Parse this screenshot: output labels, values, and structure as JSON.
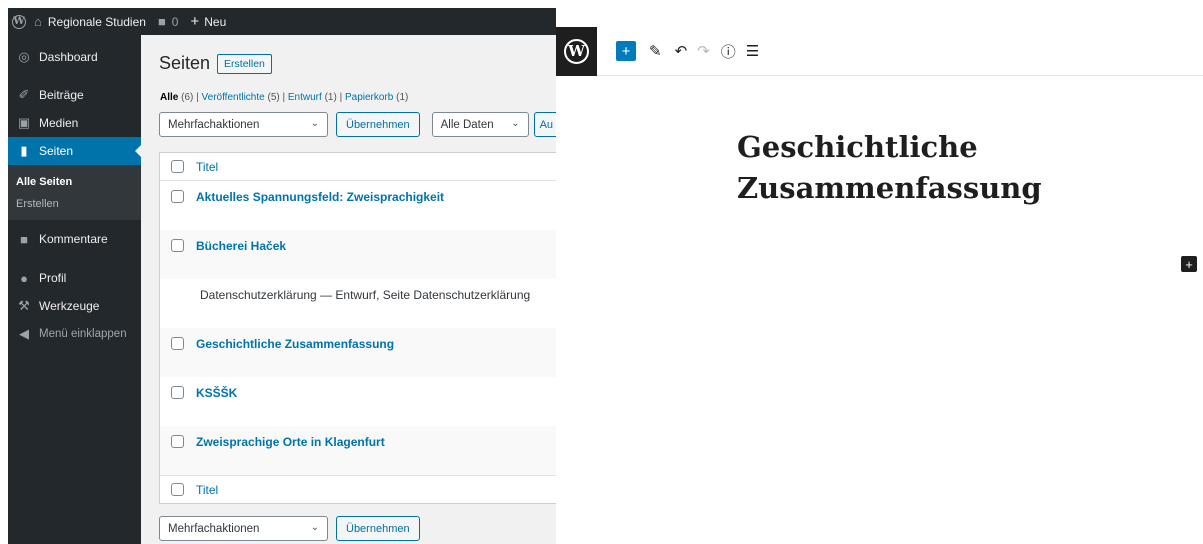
{
  "adminbar": {
    "site_name": "Regionale Studien",
    "comments_count": "0",
    "new_label": "Neu"
  },
  "sidebar": {
    "items": [
      {
        "label": "Dashboard",
        "icon": "dashboard-icon"
      },
      {
        "label": "Beiträge",
        "icon": "pin-icon"
      },
      {
        "label": "Medien",
        "icon": "media-icon"
      },
      {
        "label": "Seiten",
        "icon": "page-icon"
      },
      {
        "label": "Kommentare",
        "icon": "comment-icon"
      },
      {
        "label": "Profil",
        "icon": "user-icon"
      },
      {
        "label": "Werkzeuge",
        "icon": "wrench-icon"
      },
      {
        "label": "Menü einklappen",
        "icon": "collapse-icon"
      }
    ],
    "submenu": [
      {
        "label": "Alle Seiten"
      },
      {
        "label": "Erstellen"
      }
    ]
  },
  "pages": {
    "title": "Seiten",
    "add_new": "Erstellen",
    "views": {
      "all": "Alle",
      "all_count": "(6)",
      "published": "Veröffentlichte",
      "published_count": "(5)",
      "draft": "Entwurf",
      "draft_count": "(1)",
      "trash": "Papierkorb",
      "trash_count": "(1)"
    },
    "bulk_actions": "Mehrfachaktionen",
    "apply": "Übernehmen",
    "date_filter": "Alle Daten",
    "filter_button_partial": "Au",
    "column_title": "Titel",
    "rows": [
      {
        "title": "Aktuelles Spannungsfeld: Zweisprachigkeit"
      },
      {
        "title": "Bücherei Haček"
      },
      {
        "title": "Datenschutzerklärung — Entwurf, Seite Datenschutzerklärung"
      },
      {
        "title": "Geschichtliche Zusammenfassung"
      },
      {
        "title": "KSŠŠK"
      },
      {
        "title": "Zweisprachige Orte in Klagenfurt"
      }
    ]
  },
  "editor": {
    "toolbar": {
      "insert_icon": "plus-icon",
      "tools_icon": "pencil-icon",
      "undo_icon": "undo-icon",
      "redo_icon": "redo-icon",
      "info_icon": "info-icon",
      "outline_icon": "list-view-icon"
    },
    "post_title": "Geschichtliche Zusammenfassung"
  }
}
